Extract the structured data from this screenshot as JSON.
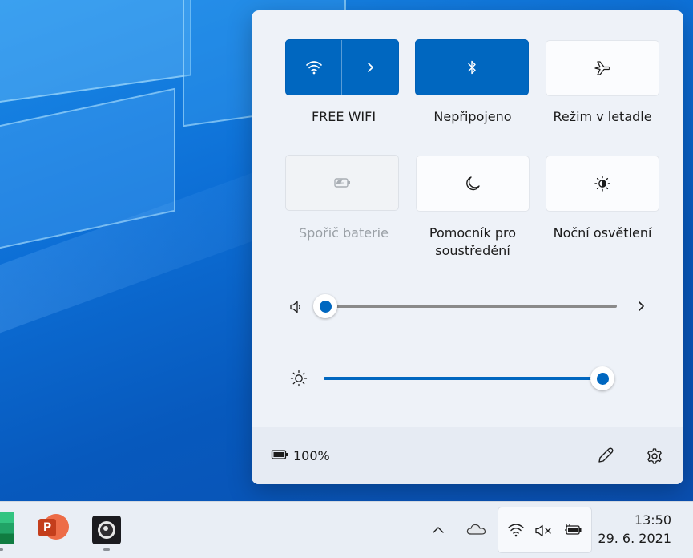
{
  "quick_settings": {
    "tiles": [
      {
        "label": "FREE WIFI",
        "state": "on",
        "icon": "wifi-icon"
      },
      {
        "label": "Nepřipojeno",
        "state": "on",
        "icon": "bluetooth-icon"
      },
      {
        "label": "Režim v letadle",
        "state": "off",
        "icon": "airplane-icon"
      },
      {
        "label": "Spořič baterie",
        "state": "disabled",
        "icon": "battery-saver-icon"
      },
      {
        "label": "Pomocník pro\nsoustředění",
        "state": "off",
        "icon": "moon-icon"
      },
      {
        "label": "Noční osvětlení",
        "state": "off",
        "icon": "night-light-icon"
      }
    ],
    "volume": {
      "level": 0.0,
      "icon": "speaker-icon"
    },
    "brightness": {
      "level": 1.0,
      "icon": "sun-icon"
    },
    "footer": {
      "battery_text": "100%",
      "icons": [
        "battery-icon",
        "pencil-icon",
        "gear-icon"
      ]
    }
  },
  "taskbar": {
    "apps": [
      "excel-icon",
      "powerpoint-icon",
      "obs-icon"
    ],
    "tray_icons": [
      "chevron-up-icon",
      "cloud-icon",
      "wifi-icon",
      "speaker-muted-icon",
      "battery-charging-icon"
    ],
    "time": "13:50",
    "date": "29. 6. 2021"
  },
  "colors": {
    "accent": "#0067c0",
    "panel": "#eef2f8",
    "taskbar": "#e9eef5"
  }
}
